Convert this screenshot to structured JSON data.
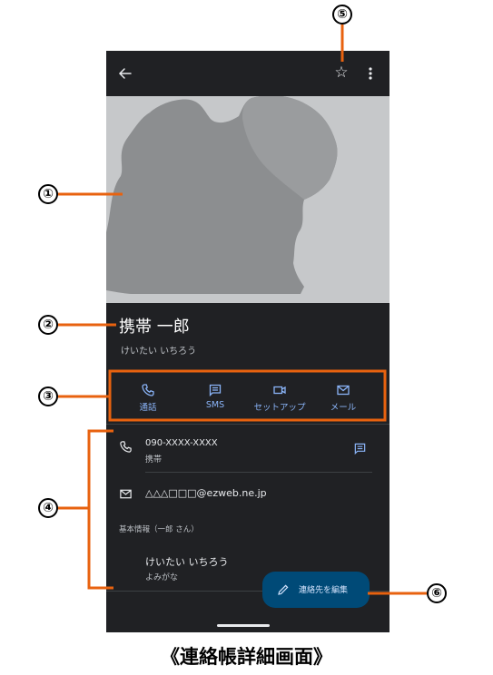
{
  "appbar": {
    "back_icon": "arrow-back-icon",
    "favorite_icon": "star-outline-icon",
    "favorite_glyph": "☆",
    "more_icon": "more-vert-icon"
  },
  "contact": {
    "name": "携帯 一郎",
    "name_reading": "けいたい いちろう"
  },
  "actions": [
    {
      "label": "通話",
      "icon": "phone-icon"
    },
    {
      "label": "SMS",
      "icon": "message-icon"
    },
    {
      "label": "セットアップ",
      "icon": "video-icon"
    },
    {
      "label": "メール",
      "icon": "mail-icon"
    }
  ],
  "details": {
    "phone_number": "090-XXXX-XXXX",
    "phone_type": "携帯",
    "email": "△△△□□□@ezweb.ne.jp",
    "section_title": "基本情報（一郎 さん）",
    "reading_value": "けいたい いちろう",
    "reading_label": "よみがな"
  },
  "fab": {
    "label": "連絡先を編集",
    "icon": "pencil-icon"
  },
  "callouts": [
    "①",
    "②",
    "③",
    "④",
    "⑤",
    "⑥"
  ],
  "caption": "《連絡帳詳細画面》",
  "colors": {
    "background": "#202124",
    "accent": "#8ab4f8",
    "callout_line": "#e8620f",
    "fab": "#004a77"
  }
}
